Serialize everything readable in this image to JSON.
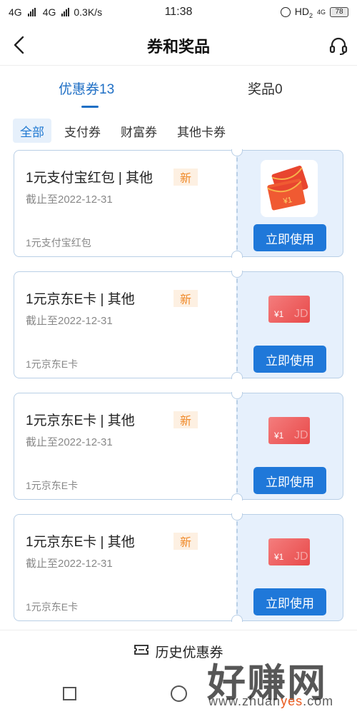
{
  "status_bar": {
    "network1": "4G",
    "network2": "4G",
    "speed": "0.3K/s",
    "time": "11:38",
    "hd": "HD",
    "hd_sub": "2",
    "sub_network": "4G",
    "battery": "78"
  },
  "nav": {
    "title": "券和奖品",
    "back_icon": "chevron-left-icon",
    "support_icon": "headset-icon"
  },
  "tabs": [
    {
      "label": "优惠券13",
      "active": true
    },
    {
      "label": "奖品0",
      "active": false
    }
  ],
  "filters": [
    {
      "label": "全部",
      "active": true
    },
    {
      "label": "支付券",
      "active": false
    },
    {
      "label": "财富券",
      "active": false
    },
    {
      "label": "其他卡券",
      "active": false
    }
  ],
  "coupons": [
    {
      "title": "1元支付宝红包 | 其他",
      "badge": "新",
      "expiry": "截止至2022-12-31",
      "desc": "1元支付宝红包",
      "button": "立即使用",
      "image": "red-packet-icon"
    },
    {
      "title": "1元京东E卡 | 其他",
      "badge": "新",
      "expiry": "截止至2022-12-31",
      "desc": "1元京东E卡",
      "button": "立即使用",
      "image": "jd-card-icon"
    },
    {
      "title": "1元京东E卡 | 其他",
      "badge": "新",
      "expiry": "截止至2022-12-31",
      "desc": "1元京东E卡",
      "button": "立即使用",
      "image": "jd-card-icon"
    },
    {
      "title": "1元京东E卡 | 其他",
      "badge": "新",
      "expiry": "截止至2022-12-31",
      "desc": "1元京东E卡",
      "button": "立即使用",
      "image": "jd-card-icon"
    }
  ],
  "card_image_text": {
    "amount": "¥1",
    "brand_letters": "JD"
  },
  "history": {
    "label": "历史优惠券",
    "icon": "ticket-icon"
  },
  "watermark": {
    "big": "好赚网",
    "small_prefix": "www.zhuan",
    "small_accent": "yes",
    "small_suffix": ".com"
  },
  "colors": {
    "accent": "#1f78d9",
    "badge_text": "#f08a2a",
    "card_border": "#b9cfe6",
    "card_right_bg": "#e6f0fc"
  }
}
